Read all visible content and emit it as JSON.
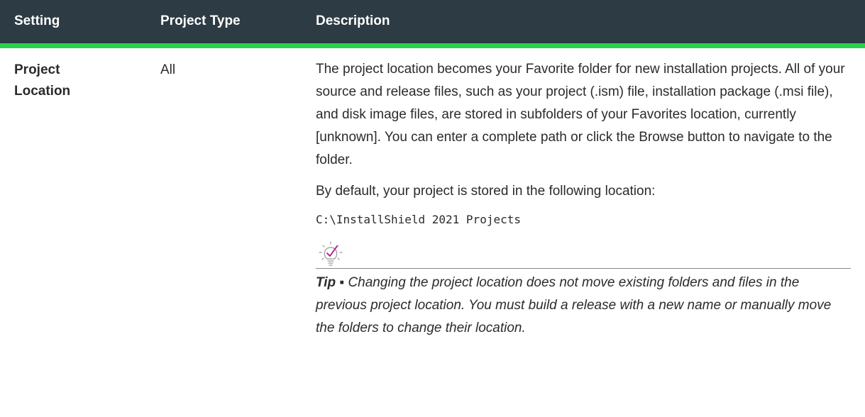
{
  "table": {
    "headers": {
      "setting": "Setting",
      "project_type": "Project Type",
      "description": "Description"
    },
    "row": {
      "setting_line1": "Project",
      "setting_line2": "Location",
      "project_type": "All",
      "description_p1": "The project location becomes your Favorite folder for new installation projects. All of your source and release files, such as your project (.ism) file, installation package (.msi file), and disk image files, are stored in subfolders of your Favorites location, currently [unknown]. You can enter a complete path or click the Browse button to navigate to the folder.",
      "description_p2": "By default, your project is stored in the following location:",
      "default_path": "C:\\InstallShield 2021 Projects",
      "tip": {
        "icon": "lightbulb-check-icon",
        "label": "Tip",
        "separator": " ▪ ",
        "text": "Changing the project location does not move existing folders and files in the previous project location. You must build a release with a new name or manually move the folders to change their location."
      }
    }
  },
  "colors": {
    "header_background": "#2c3b44",
    "header_accent": "#28d34a",
    "tip_icon": "#b0158c"
  }
}
